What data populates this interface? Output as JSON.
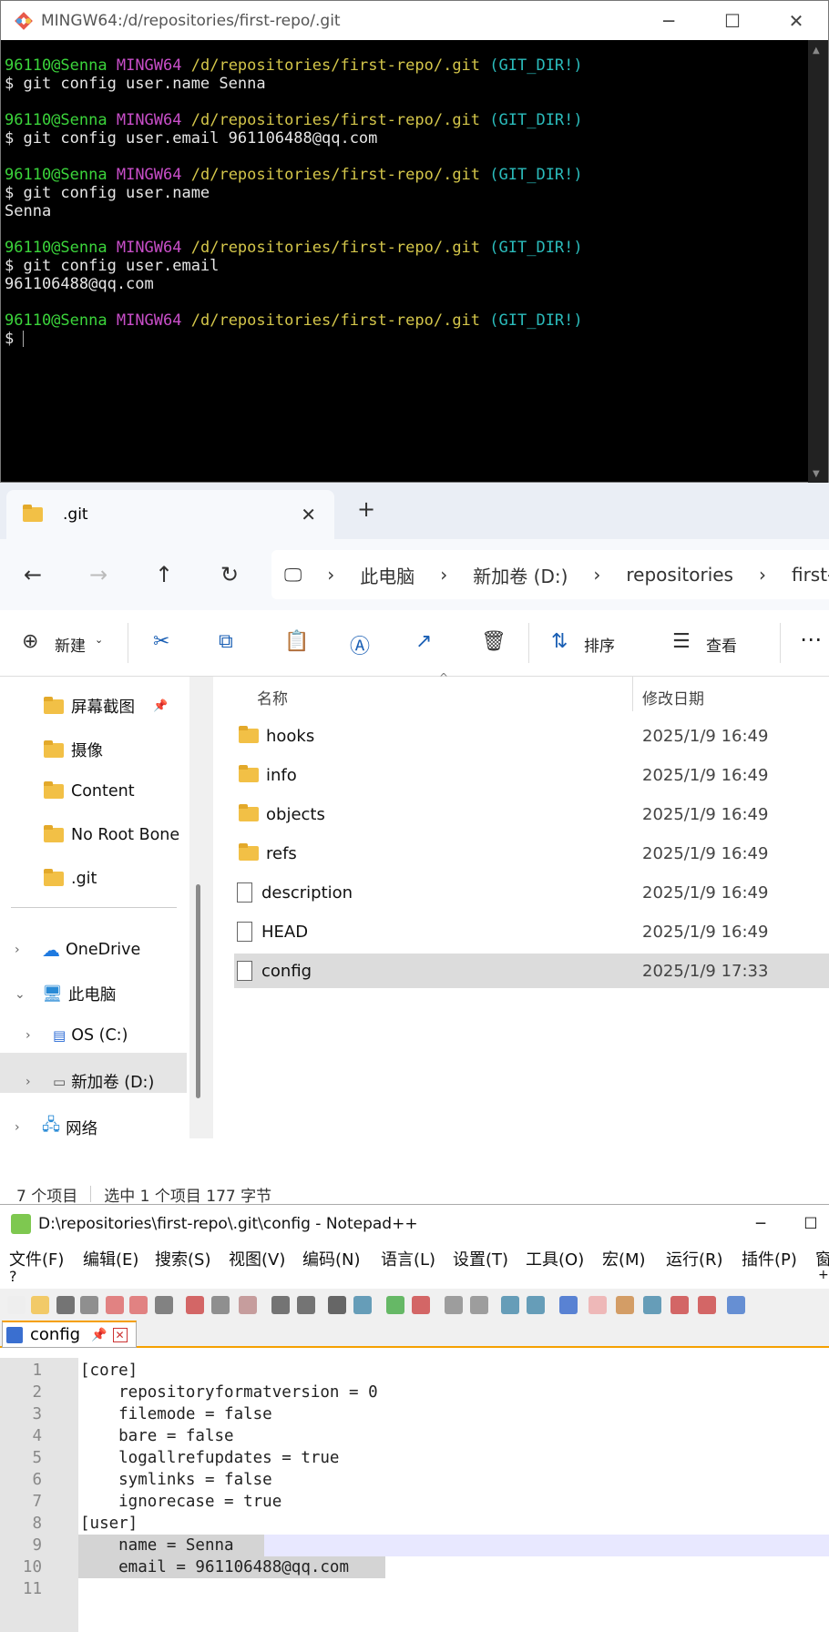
{
  "terminal": {
    "title": "MINGW64:/d/repositories/first-repo/.git",
    "prompt_user": "96110@Senna",
    "prompt_sys": "MINGW64",
    "prompt_path": "/d/repositories/first-repo/.git",
    "prompt_tag": "(GIT_DIR!)",
    "blocks": [
      {
        "cmd": "$ git config user.name Senna",
        "out": ""
      },
      {
        "cmd": "$ git config user.email 961106488@qq.com",
        "out": ""
      },
      {
        "cmd": "$ git config user.name",
        "out": "Senna"
      },
      {
        "cmd": "$ git config user.email",
        "out": "961106488@qq.com"
      }
    ],
    "final_prompt": "$ "
  },
  "explorer": {
    "tab_title": ".git",
    "tab_close": "✕",
    "new_tab": "+",
    "breadcrumbs": [
      "此电脑",
      "新加卷 (D:)",
      "repositories",
      "first-"
    ],
    "crumb_sep": "›",
    "cmd": {
      "new": "新建",
      "sort": "排序",
      "view": "查看",
      "more": "⋯"
    },
    "nav_items": [
      {
        "label": "屏幕截图",
        "pinned": true
      },
      {
        "label": "摄像"
      },
      {
        "label": "Content"
      },
      {
        "label": "No Root Bone"
      },
      {
        "label": ".git"
      },
      {
        "label": "OneDrive"
      },
      {
        "label": "此电脑"
      },
      {
        "label": "OS (C:)"
      },
      {
        "label": "新加卷 (D:)"
      },
      {
        "label": "网络"
      }
    ],
    "col_name": "名称",
    "col_date": "修改日期",
    "files": [
      {
        "name": "hooks",
        "date": "2025/1/9 16:49",
        "type": "folder"
      },
      {
        "name": "info",
        "date": "2025/1/9 16:49",
        "type": "folder"
      },
      {
        "name": "objects",
        "date": "2025/1/9 16:49",
        "type": "folder"
      },
      {
        "name": "refs",
        "date": "2025/1/9 16:49",
        "type": "folder"
      },
      {
        "name": "description",
        "date": "2025/1/9 16:49",
        "type": "file"
      },
      {
        "name": "HEAD",
        "date": "2025/1/9 16:49",
        "type": "file"
      },
      {
        "name": "config",
        "date": "2025/1/9 17:33",
        "type": "file",
        "selected": true
      }
    ],
    "status": {
      "count": "7 个项目",
      "sel": "选中 1 个项目  177 字节"
    }
  },
  "notepad": {
    "title": "D:\\repositories\\first-repo\\.git\\config - Notepad++",
    "menu": [
      "文件(F)",
      "编辑(E)",
      "搜索(S)",
      "视图(V)",
      "编码(N)",
      "语言(L)",
      "设置(T)",
      "工具(O)",
      "宏(M)",
      "运行(R)",
      "插件(P)",
      "窗"
    ],
    "menu_q": "?",
    "menu_plus": "+",
    "tab": "config",
    "lines": [
      "[core]",
      "    repositoryformatversion = 0",
      "    filemode = false",
      "    bare = false",
      "    logallrefupdates = true",
      "    symlinks = false",
      "    ignorecase = true",
      "[user]",
      "    name = Senna",
      "    email = 961106488@qq.com",
      ""
    ]
  },
  "colors": {
    "selection": "#d4d4d4",
    "terminal_green": "#3bd43b",
    "terminal_magenta": "#c84ec8",
    "terminal_yellow": "#d4c64a",
    "terminal_cyan": "#2bbcbc"
  }
}
